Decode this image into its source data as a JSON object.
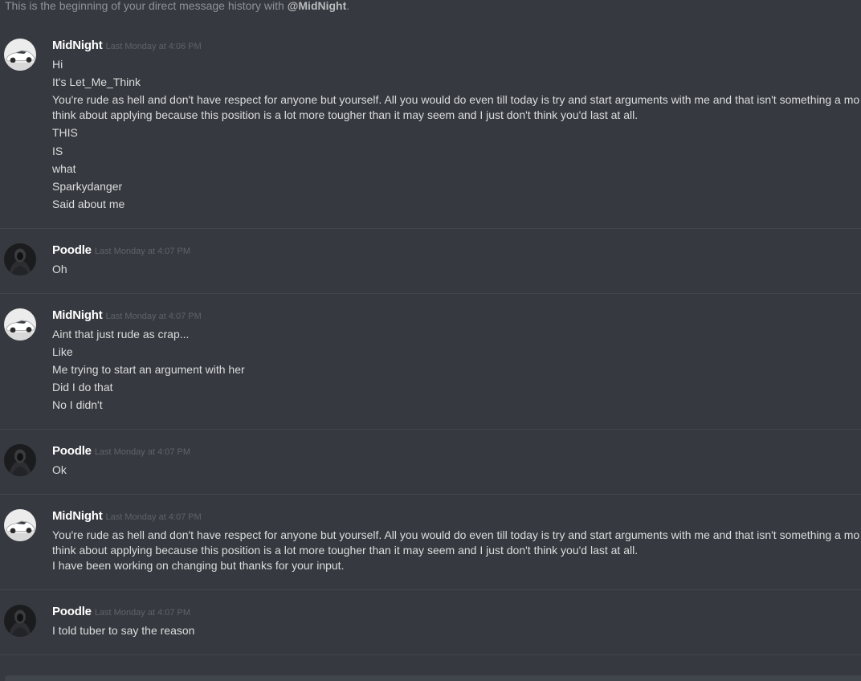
{
  "intro": {
    "prefix": "This is the beginning of your direct message history with ",
    "mention": "@MidNight",
    "suffix": "."
  },
  "messages": [
    {
      "user": "MidNight",
      "timestamp": "Last Monday at 4:06 PM",
      "avatar_icon": "white-sports-car-avatar",
      "lines": [
        "Hi",
        "It's Let_Me_Think",
        "You're rude as hell and don't have respect for anyone but yourself. All you would do even till today is try and start arguments with me and that isn't something a mo",
        "think about applying because this position is a lot more tougher than it may seem and I just don't think you'd last at all.",
        "THIS",
        "IS",
        "what",
        "Sparkydanger",
        "Said about me"
      ]
    },
    {
      "user": "Poodle",
      "timestamp": "Last Monday at 4:07 PM",
      "avatar_icon": "dark-hooded-figure-avatar",
      "lines": [
        "Oh"
      ]
    },
    {
      "user": "MidNight",
      "timestamp": "Last Monday at 4:07 PM",
      "avatar_icon": "white-sports-car-avatar",
      "lines": [
        "Aint that just rude as crap...",
        "Like",
        "Me trying to start an argument with her",
        "Did I do that",
        "No I didn't"
      ]
    },
    {
      "user": "Poodle",
      "timestamp": "Last Monday at 4:07 PM",
      "avatar_icon": "dark-hooded-figure-avatar",
      "lines": [
        "Ok"
      ]
    },
    {
      "user": "MidNight",
      "timestamp": "Last Monday at 4:07 PM",
      "avatar_icon": "white-sports-car-avatar",
      "lines": [
        "You're rude as hell and don't have respect for anyone but yourself. All you would do even till today is try and start arguments with me and that isn't something a mo",
        "think about applying because this position is a lot more tougher than it may seem and I just don't think you'd last at all.",
        "I have been working on changing but thanks for your input."
      ]
    },
    {
      "user": "Poodle",
      "timestamp": "Last Monday at 4:07 PM",
      "avatar_icon": "dark-hooded-figure-avatar",
      "lines": [
        "I told tuber to say the reason"
      ]
    }
  ],
  "colors": {
    "background": "#36393f",
    "username": "#ffffff",
    "message_text": "#dcddde",
    "timestamp": "#5f6368",
    "divider": "#42454a"
  }
}
